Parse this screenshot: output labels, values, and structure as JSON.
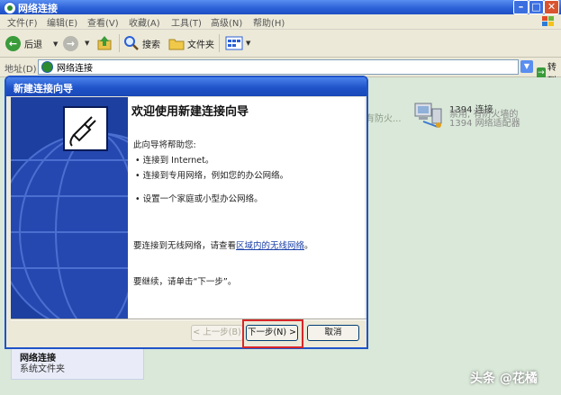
{
  "window": {
    "title": "网络连接"
  },
  "menu": [
    "文件(F)",
    "编辑(E)",
    "查看(V)",
    "收藏(A)",
    "工具(T)",
    "高级(N)",
    "帮助(H)"
  ],
  "toolbar": {
    "back": "后退",
    "search": "搜索",
    "folders": "文件夹"
  },
  "address": {
    "label": "地址(D)",
    "value": "网络连接",
    "go": "转到"
  },
  "connections": [
    {
      "name": "1394 连接",
      "status": "禁用, 有防火墙的",
      "device": "1394 网络适配器"
    }
  ],
  "partial_text": "有防火...",
  "side_panel": {
    "title": "网络连接",
    "subtitle": "系统文件夹"
  },
  "wizard": {
    "title": "新建连接向导",
    "heading": "欢迎使用新建连接向导",
    "intro": "此向导将帮助您:",
    "bullets": [
      "连接到 Internet。",
      "连接到专用网络，例如您的办公网络。",
      "设置一个家庭或小型办公网络。"
    ],
    "wireless_prefix": "要连接到无线网络，请查看",
    "wireless_link": "区域内的无线网络",
    "wireless_suffix": "。",
    "continue": "要继续，请单击“下一步”。",
    "btn_back": "< 上一步(B)",
    "btn_next": "下一步(N) >",
    "btn_cancel": "取消"
  },
  "watermark": "头条 @花橘",
  "colors": {
    "titlebar": "#2a5fd6",
    "highlight": "#d8262a",
    "wizard_panel": "#1c3fa0"
  }
}
